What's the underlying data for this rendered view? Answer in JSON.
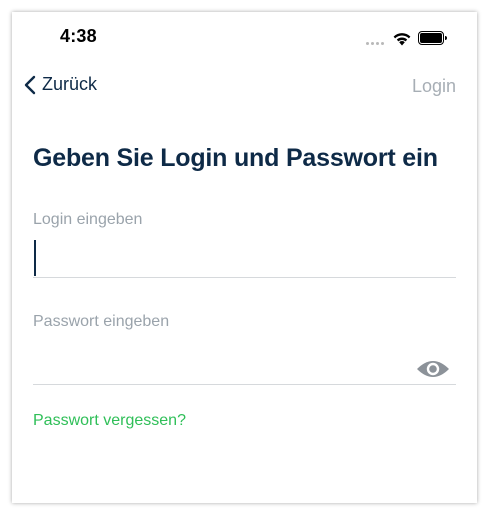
{
  "status_bar": {
    "time": "4:38"
  },
  "nav": {
    "back_label": "Zurück",
    "right_label": "Login"
  },
  "form": {
    "title": "Geben Sie Login und Passwort ein",
    "login_label": "Login eingeben",
    "login_value": "",
    "password_label": "Passwort eingeben",
    "password_value": "",
    "forgot_label": "Passwort vergessen?"
  },
  "colors": {
    "primary": "#0e2a47",
    "muted": "#9aa3ab",
    "link": "#2fbf58",
    "divider": "#d6d9dc"
  },
  "icons": {
    "back": "chevron-left-icon",
    "wifi": "wifi-icon",
    "battery": "battery-icon",
    "signal": "signal-dots-icon",
    "eye": "eye-icon"
  }
}
